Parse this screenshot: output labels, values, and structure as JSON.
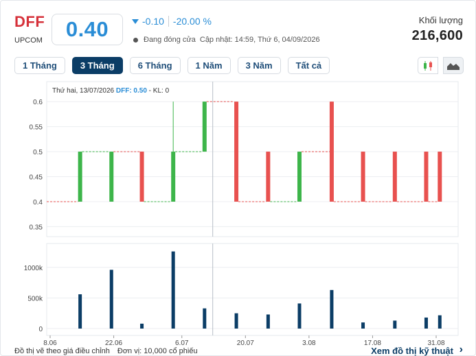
{
  "header": {
    "ticker": "DFF",
    "exchange": "UPCOM",
    "price": "0.40",
    "change": "-0.10",
    "change_pct": "-20.00 %",
    "status": "Đang đóng cửa",
    "updated": "Cập nhật: 14:59, Thứ 6, 04/09/2026",
    "volume_label": "Khối lượng",
    "volume_value": "216,600"
  },
  "tabs": [
    {
      "label": "1 Tháng",
      "active": false
    },
    {
      "label": "3 Tháng",
      "active": true
    },
    {
      "label": "6 Tháng",
      "active": false
    },
    {
      "label": "1 Năm",
      "active": false
    },
    {
      "label": "3 Năm",
      "active": false
    },
    {
      "label": "Tất cả",
      "active": false
    }
  ],
  "chart_type_buttons": [
    {
      "icon": "candlestick-icon",
      "active": false
    },
    {
      "icon": "area-chart-icon",
      "active": true
    }
  ],
  "tooltip": {
    "date": "Thứ hai, 13/07/2026",
    "symbol_label": "DFF:",
    "value": "0.50",
    "kl": "- KL: 0"
  },
  "colors": {
    "up": "#3db54a",
    "down": "#e8514f",
    "volume": "#0b3d66",
    "accent": "#2a8dd6",
    "ticker": "#d6313a"
  },
  "footer": {
    "note": "Đồ thị vẽ theo giá điều chỉnh",
    "unit": "Đơn vị: 10,000 cổ phiếu",
    "link": "Xem đồ thị kỹ thuật"
  },
  "chart_data": {
    "type": "candlestick",
    "price_axis": {
      "ticks": [
        0.6,
        0.55,
        0.5,
        0.45,
        0.4,
        0.35
      ],
      "tick_labels": [
        "0.6",
        "0.55",
        "0.5",
        "0.45",
        "0.4",
        "0.35"
      ],
      "ylim": [
        0.33,
        0.64
      ]
    },
    "volume_axis": {
      "ticks": [
        1000000,
        500000,
        0
      ],
      "tick_labels": [
        "1000k",
        "500k",
        "0"
      ],
      "ylim": [
        0,
        1300000
      ]
    },
    "x_ticks": [
      {
        "day": 0,
        "label": "8.06"
      },
      {
        "day": 14,
        "label": "22.06"
      },
      {
        "day": 29,
        "label": "6.07"
      },
      {
        "day": 43,
        "label": "20.07"
      },
      {
        "day": 57,
        "label": "3.08"
      },
      {
        "day": 71,
        "label": "17.08"
      },
      {
        "day": 85,
        "label": "31.08"
      }
    ],
    "x_range": [
      0,
      88
    ],
    "candles": [
      {
        "day": 6.6,
        "o": 0.4,
        "h": 0.5,
        "l": 0.4,
        "c": 0.5,
        "vol": 560000
      },
      {
        "day": 13.5,
        "o": 0.4,
        "h": 0.5,
        "l": 0.4,
        "c": 0.5,
        "vol": 960000
      },
      {
        "day": 20.2,
        "o": 0.5,
        "h": 0.5,
        "l": 0.4,
        "c": 0.4,
        "vol": 80000
      },
      {
        "day": 27.1,
        "o": 0.4,
        "h": 0.6,
        "l": 0.4,
        "c": 0.5,
        "vol": 1260000
      },
      {
        "day": 34.0,
        "o": 0.5,
        "h": 0.6,
        "l": 0.5,
        "c": 0.6,
        "vol": 330000
      },
      {
        "day": 41.0,
        "o": 0.6,
        "h": 0.6,
        "l": 0.4,
        "c": 0.4,
        "vol": 250000
      },
      {
        "day": 48.0,
        "o": 0.5,
        "h": 0.5,
        "l": 0.4,
        "c": 0.4,
        "vol": 230000
      },
      {
        "day": 54.9,
        "o": 0.4,
        "h": 0.5,
        "l": 0.4,
        "c": 0.5,
        "vol": 410000
      },
      {
        "day": 62.0,
        "o": 0.6,
        "h": 0.6,
        "l": 0.4,
        "c": 0.4,
        "vol": 630000
      },
      {
        "day": 68.9,
        "o": 0.5,
        "h": 0.5,
        "l": 0.4,
        "c": 0.4,
        "vol": 100000
      },
      {
        "day": 75.9,
        "o": 0.5,
        "h": 0.5,
        "l": 0.4,
        "c": 0.4,
        "vol": 130000
      },
      {
        "day": 82.8,
        "o": 0.5,
        "h": 0.5,
        "l": 0.4,
        "c": 0.4,
        "vol": 180000
      },
      {
        "day": 85.8,
        "o": 0.5,
        "h": 0.5,
        "l": 0.4,
        "c": 0.4,
        "vol": 216600
      }
    ],
    "crosshair_day": 35.8,
    "grid": true
  }
}
